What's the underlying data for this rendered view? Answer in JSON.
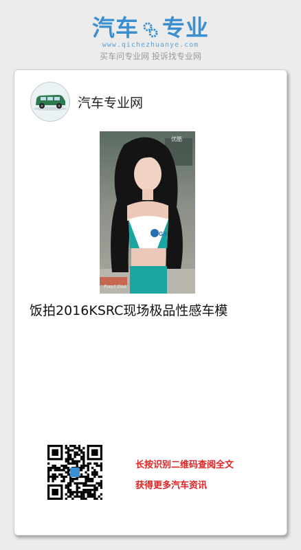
{
  "header": {
    "logo_title_left": "汽车",
    "logo_title_right": "专业",
    "logo_url": "www.qichezhuanye.com",
    "logo_tagline": "买车问专业网 投诉找专业网"
  },
  "card": {
    "site_name": "汽车专业网",
    "photo_watermark_top": "优酷",
    "photo_watermark_bottom": "Pany1 Diuk",
    "photo_badge": "GS",
    "article_title": "饭拍2016KSRC现场极品性感车模",
    "cta_line1": "长按识别二维码查阅全文",
    "cta_line2": "获得更多汽车资讯"
  },
  "colors": {
    "brand_blue": "#3a8fd0",
    "cta_red": "#e02222",
    "background": "#ececec"
  },
  "icons": [
    "gear-icon",
    "car-avatar-icon",
    "qr-code"
  ]
}
